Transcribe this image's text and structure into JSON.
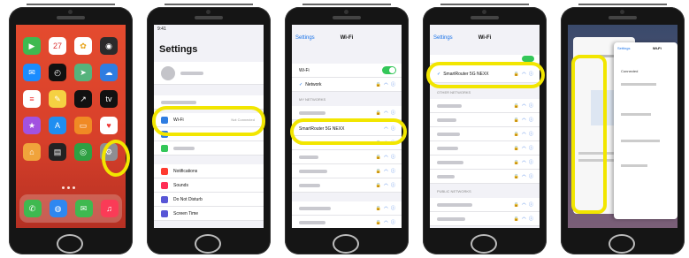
{
  "home_screen": {
    "apps": [
      {
        "icon": "facetime-icon",
        "color": "#3fb950",
        "glyph": "▶"
      },
      {
        "icon": "calendar-icon",
        "color": "#ffffff",
        "glyph": "27",
        "text_color": "#d33"
      },
      {
        "icon": "photos-icon",
        "color": "#ffffff",
        "glyph": "✿",
        "text_color": "#e8a317"
      },
      {
        "icon": "camera-icon",
        "color": "#2b2b2b",
        "glyph": "◉"
      },
      {
        "icon": "mail-icon",
        "color": "#1a8cff",
        "glyph": "✉"
      },
      {
        "icon": "clock-icon",
        "color": "#111111",
        "glyph": "◴"
      },
      {
        "icon": "maps-icon",
        "color": "#56b37c",
        "glyph": "➤"
      },
      {
        "icon": "weather-icon",
        "color": "#2f7de1",
        "glyph": "☁"
      },
      {
        "icon": "reminders-icon",
        "color": "#ffffff",
        "glyph": "≡",
        "text_color": "#e33"
      },
      {
        "icon": "notes-icon",
        "color": "#f5d142",
        "glyph": "✎"
      },
      {
        "icon": "stocks-icon",
        "color": "#111111",
        "glyph": "↗"
      },
      {
        "icon": "tv-icon",
        "color": "#111111",
        "glyph": "tv"
      },
      {
        "icon": "podcasts-icon",
        "color": "#a252e0",
        "glyph": "★"
      },
      {
        "icon": "appstore-icon",
        "color": "#1f8ef1",
        "glyph": "A"
      },
      {
        "icon": "books-icon",
        "color": "#f08a24",
        "glyph": "▭"
      },
      {
        "icon": "health-icon",
        "color": "#ffffff",
        "glyph": "♥",
        "text_color": "#e33"
      },
      {
        "icon": "home-app-icon",
        "color": "#f0a33b",
        "glyph": "⌂"
      },
      {
        "icon": "wallet-icon",
        "color": "#222222",
        "glyph": "▤"
      },
      {
        "icon": "find-my-icon",
        "color": "#2ea043",
        "glyph": "◎"
      },
      {
        "icon": "settings-icon",
        "color": "#8e8e93",
        "glyph": "⚙"
      }
    ],
    "dock": [
      {
        "icon": "phone-icon",
        "color": "#3fb950",
        "glyph": "✆"
      },
      {
        "icon": "safari-icon",
        "color": "#2f87f0",
        "glyph": "◍"
      },
      {
        "icon": "messages-icon",
        "color": "#3fb950",
        "glyph": "✉"
      },
      {
        "icon": "music-icon",
        "color": "#fa3b57",
        "glyph": "♫"
      }
    ]
  },
  "settings_screen": {
    "title": "Settings",
    "status_time": "9:41",
    "wifi_label": "Wi-Fi",
    "wifi_value": "Not Connected",
    "items": [
      "Notifications",
      "Sounds",
      "Do Not Disturb",
      "Screen Time"
    ]
  },
  "wifi_screen": {
    "back": "Settings",
    "title": "Wi-Fi",
    "toggle_label": "Wi-Fi",
    "connected": "Network",
    "section": "MY NETWORKS",
    "selected_network": "SmartRouter 5G NEXX"
  },
  "wifi_connected_screen": {
    "back": "Settings",
    "title": "Wi-Fi",
    "selected_network": "SmartRouter 5G NEXX",
    "section_other": "OTHER NETWORKS",
    "section_public": "PUBLIC NETWORKS"
  },
  "split_screen": {
    "back": "Settings",
    "title": "Wi-Fi",
    "status": "Connected"
  },
  "colors": {
    "highlight": "#f2e600",
    "ios_blue": "#1a73e8",
    "toggle_green": "#34c759"
  }
}
